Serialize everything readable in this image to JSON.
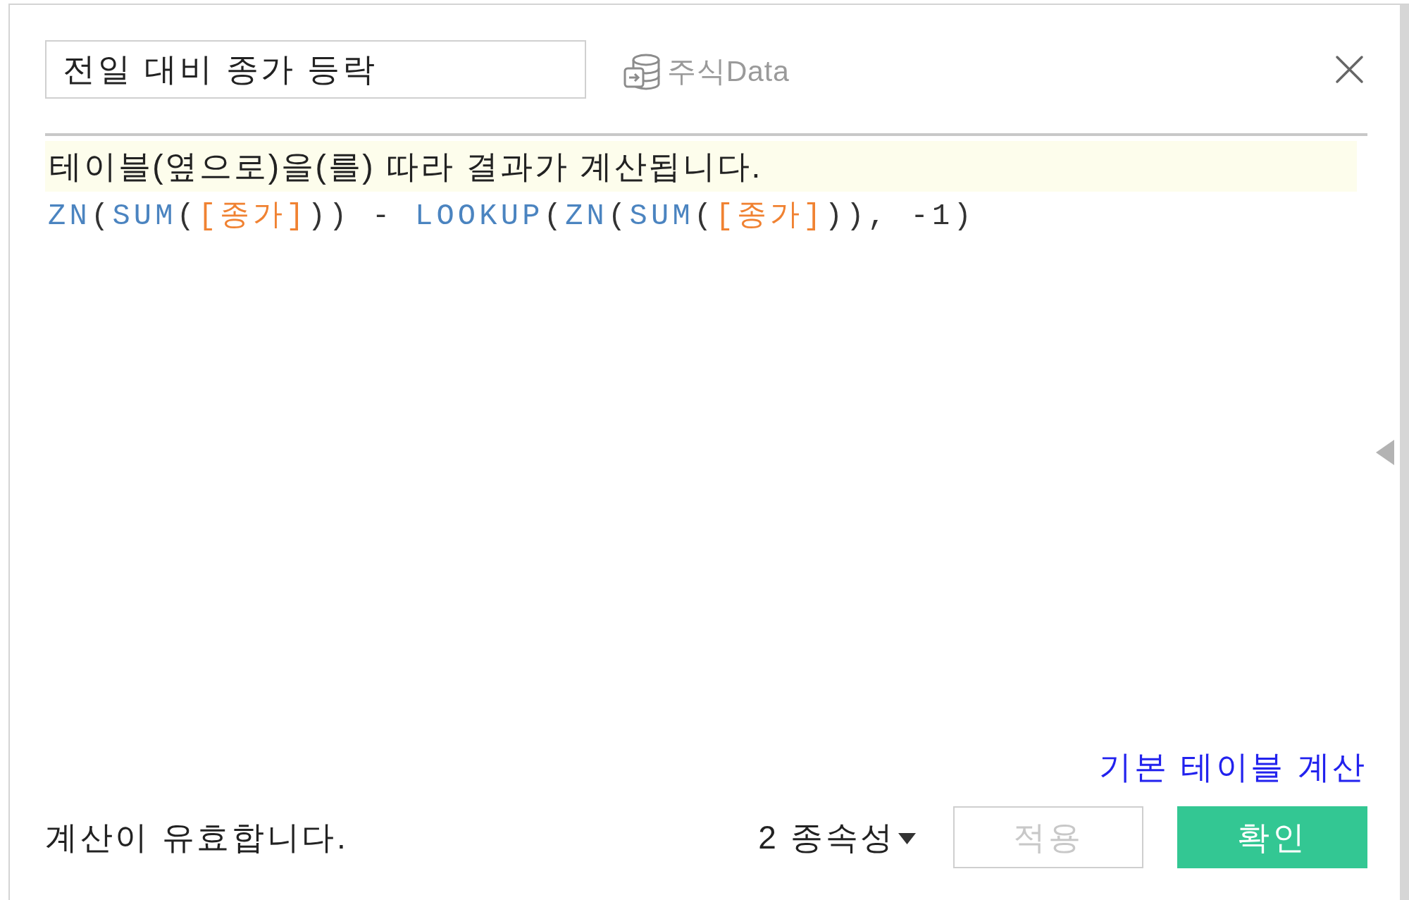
{
  "title_field": {
    "value": "전일 대비 종가 등락"
  },
  "data_source": {
    "label": "주식Data"
  },
  "info_banner": {
    "text": "테이블(옆으로)을(를) 따라 결과가 계산됩니다."
  },
  "formula": {
    "tokens": [
      {
        "kind": "function",
        "text": "ZN"
      },
      {
        "kind": "punct",
        "text": "("
      },
      {
        "kind": "function",
        "text": "SUM"
      },
      {
        "kind": "punct",
        "text": "("
      },
      {
        "kind": "field",
        "text": "[종가]"
      },
      {
        "kind": "punct",
        "text": ")) - "
      },
      {
        "kind": "function",
        "text": "LOOKUP"
      },
      {
        "kind": "punct",
        "text": "("
      },
      {
        "kind": "function",
        "text": "ZN"
      },
      {
        "kind": "punct",
        "text": "("
      },
      {
        "kind": "function",
        "text": "SUM"
      },
      {
        "kind": "punct",
        "text": "("
      },
      {
        "kind": "field",
        "text": "[종가]"
      },
      {
        "kind": "punct",
        "text": ")), -1)"
      }
    ]
  },
  "default_calc_link": {
    "label": "기본 테이블 계산"
  },
  "status": {
    "text": "계산이 유효합니다."
  },
  "dependencies": {
    "label": "2 종속성"
  },
  "buttons": [
    {
      "label": "적용",
      "kind": "secondary",
      "disabled": true
    },
    {
      "label": "확인",
      "kind": "primary",
      "disabled": false
    }
  ]
}
